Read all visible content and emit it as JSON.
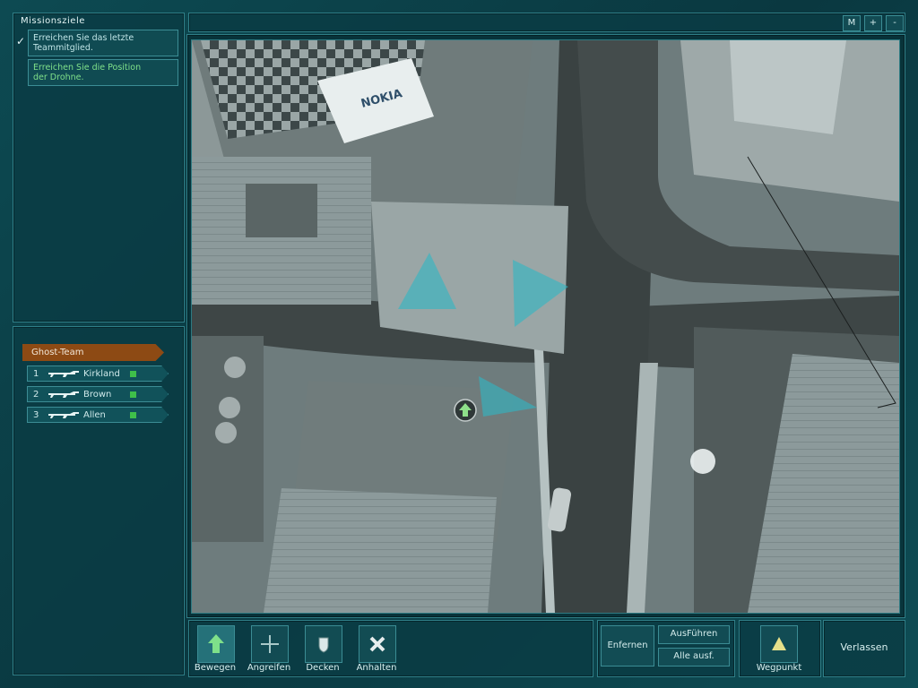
{
  "objectives": {
    "title": "Missionsziele",
    "items": [
      {
        "text_line1": "Erreichen Sie das letzte",
        "text_line2": "Teammitglied.",
        "done": true,
        "color": "#bfe4e6"
      },
      {
        "text_line1": "Erreichen Sie die Position",
        "text_line2": "der Drohne.",
        "done": false,
        "color": "#7fe08a"
      }
    ],
    "check_glyph": "✓"
  },
  "team": {
    "title": "Ghost-Team",
    "members": [
      {
        "num": "1",
        "name": "Kirkland",
        "weapon_icon": "rifle-icon"
      },
      {
        "num": "2",
        "name": "Brown",
        "weapon_icon": "rifle-icon"
      },
      {
        "num": "3",
        "name": "Allen",
        "weapon_icon": "rifle-icon"
      }
    ],
    "status_color": "#3fbf4a"
  },
  "map_controls": {
    "m": "M",
    "plus": "+",
    "minus": "-"
  },
  "toolbar": {
    "move": "Bewegen",
    "attack": "Angreifen",
    "cover": "Decken",
    "halt": "Anhalten",
    "remove": "Enfernen",
    "execute": "AusFühren",
    "execute_all": "Alle ausf.",
    "waypoint": "Wegpunkt",
    "leave": "Verlassen"
  },
  "colors": {
    "accent": "#2f7f88",
    "team_header": "#8d4a14",
    "vision_cone": "#2fb8c4"
  }
}
